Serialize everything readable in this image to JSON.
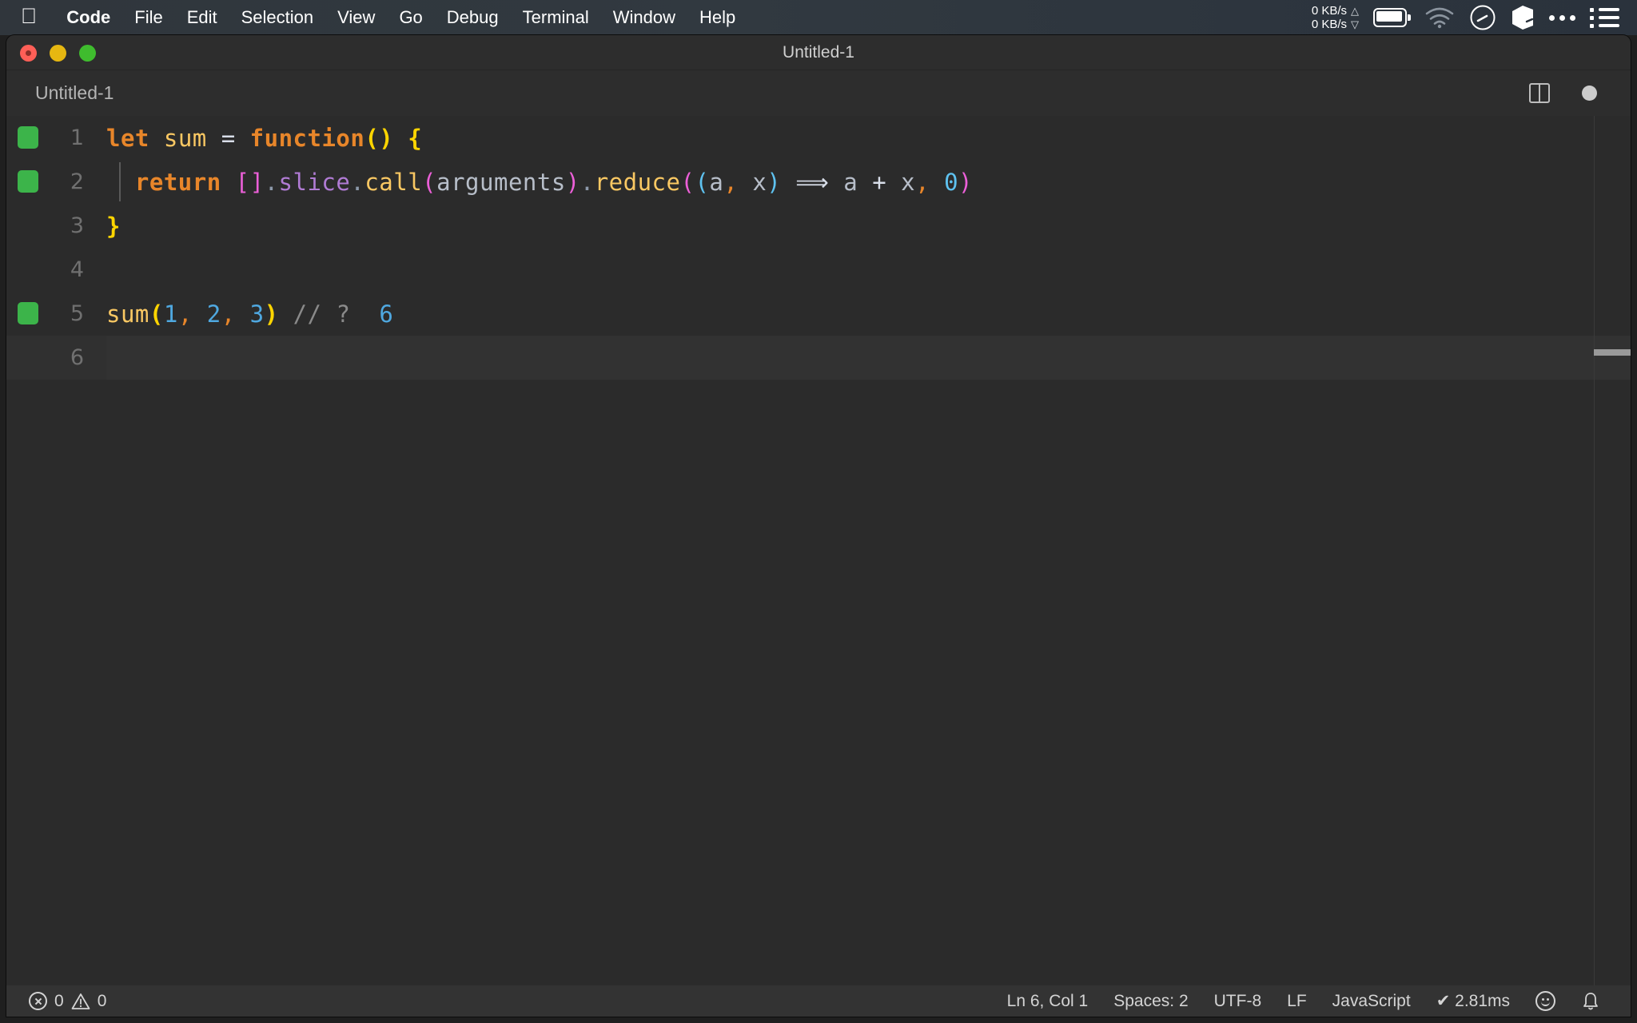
{
  "menubar": {
    "apple_icon": "apple-logo",
    "items": [
      {
        "label": "Code",
        "bold": true
      },
      {
        "label": "File",
        "bold": false
      },
      {
        "label": "Edit",
        "bold": false
      },
      {
        "label": "Selection",
        "bold": false
      },
      {
        "label": "View",
        "bold": false
      },
      {
        "label": "Go",
        "bold": false
      },
      {
        "label": "Debug",
        "bold": false
      },
      {
        "label": "Terminal",
        "bold": false
      },
      {
        "label": "Window",
        "bold": false
      },
      {
        "label": "Help",
        "bold": false
      }
    ],
    "status": {
      "net_up": "0 KB/s",
      "net_down": "0 KB/s",
      "net_up_arrow": "△",
      "net_down_arrow": "▽",
      "icons": [
        "battery-icon",
        "wifi-icon",
        "gauge-icon",
        "cube-icon",
        "ellipsis-icon",
        "list-icon"
      ]
    }
  },
  "window": {
    "title": "Untitled-1",
    "traffic_lights": [
      "close",
      "minimize",
      "maximize"
    ]
  },
  "tabbar": {
    "tab_label": "Untitled-1",
    "split_icon": "split-editor-icon",
    "dirty_icon": "unsaved-dot-icon"
  },
  "editor": {
    "language": "JavaScript",
    "lines": [
      {
        "num": "1",
        "git_added": true,
        "indent_guide": false,
        "current": false,
        "tokens": [
          {
            "t": "let",
            "c": "t-kw"
          },
          {
            "t": " ",
            "c": "t-plain"
          },
          {
            "t": "sum",
            "c": "t-var"
          },
          {
            "t": " ",
            "c": "t-plain"
          },
          {
            "t": "=",
            "c": "t-op"
          },
          {
            "t": " ",
            "c": "t-plain"
          },
          {
            "t": "function",
            "c": "t-fnkw"
          },
          {
            "t": "()",
            "c": "t-yellow"
          },
          {
            "t": " ",
            "c": "t-plain"
          },
          {
            "t": "{",
            "c": "t-yellow"
          }
        ]
      },
      {
        "num": "2",
        "git_added": true,
        "indent_guide": true,
        "current": false,
        "tokens": [
          {
            "t": "  ",
            "c": "t-plain"
          },
          {
            "t": "return",
            "c": "t-kw"
          },
          {
            "t": " ",
            "c": "t-plain"
          },
          {
            "t": "[]",
            "c": "t-pink"
          },
          {
            "t": ".",
            "c": "t-dot"
          },
          {
            "t": "slice",
            "c": "t-purple"
          },
          {
            "t": ".",
            "c": "t-dot"
          },
          {
            "t": "call",
            "c": "t-peach"
          },
          {
            "t": "(",
            "c": "t-magenta"
          },
          {
            "t": "arguments",
            "c": "t-param"
          },
          {
            "t": ")",
            "c": "t-magenta"
          },
          {
            "t": ".",
            "c": "t-dot"
          },
          {
            "t": "reduce",
            "c": "t-peach"
          },
          {
            "t": "(",
            "c": "t-magenta"
          },
          {
            "t": "(",
            "c": "t-cyan"
          },
          {
            "t": "a",
            "c": "t-param"
          },
          {
            "t": ",",
            "c": "t-comma"
          },
          {
            "t": " ",
            "c": "t-plain"
          },
          {
            "t": "x",
            "c": "t-param"
          },
          {
            "t": ")",
            "c": "t-cyan"
          },
          {
            "t": " ",
            "c": "t-plain"
          },
          {
            "t": "⟹",
            "c": "t-arrow"
          },
          {
            "t": " ",
            "c": "t-plain"
          },
          {
            "t": "a",
            "c": "t-param"
          },
          {
            "t": " ",
            "c": "t-plain"
          },
          {
            "t": "+",
            "c": "t-op"
          },
          {
            "t": " ",
            "c": "t-plain"
          },
          {
            "t": "x",
            "c": "t-param"
          },
          {
            "t": ",",
            "c": "t-comma"
          },
          {
            "t": " ",
            "c": "t-plain"
          },
          {
            "t": "0",
            "c": "t-cyan"
          },
          {
            "t": ")",
            "c": "t-magenta"
          }
        ]
      },
      {
        "num": "3",
        "git_added": false,
        "indent_guide": false,
        "current": false,
        "tokens": [
          {
            "t": "}",
            "c": "t-yellow"
          }
        ]
      },
      {
        "num": "4",
        "git_added": false,
        "indent_guide": false,
        "current": false,
        "tokens": []
      },
      {
        "num": "5",
        "git_added": true,
        "indent_guide": false,
        "current": false,
        "tokens": [
          {
            "t": "sum",
            "c": "t-peach"
          },
          {
            "t": "(",
            "c": "t-yellow"
          },
          {
            "t": "1",
            "c": "t-num"
          },
          {
            "t": ",",
            "c": "t-comma"
          },
          {
            "t": " ",
            "c": "t-plain"
          },
          {
            "t": "2",
            "c": "t-num"
          },
          {
            "t": ",",
            "c": "t-comma"
          },
          {
            "t": " ",
            "c": "t-plain"
          },
          {
            "t": "3",
            "c": "t-num"
          },
          {
            "t": ")",
            "c": "t-yellow"
          },
          {
            "t": " ",
            "c": "t-plain"
          },
          {
            "t": "// ?",
            "c": "t-comment"
          },
          {
            "t": "  ",
            "c": "t-plain"
          },
          {
            "t": "6",
            "c": "t-num"
          }
        ]
      },
      {
        "num": "6",
        "git_added": false,
        "indent_guide": false,
        "current": true,
        "tokens": []
      }
    ]
  },
  "statusbar": {
    "errors": "0",
    "warnings": "0",
    "cursor": "Ln 6, Col 1",
    "indentation": "Spaces: 2",
    "encoding": "UTF-8",
    "eol": "LF",
    "language": "JavaScript",
    "runtime": "✔ 2.81ms",
    "feedback_icon": "smiley-icon",
    "notification_icon": "bell-icon"
  }
}
